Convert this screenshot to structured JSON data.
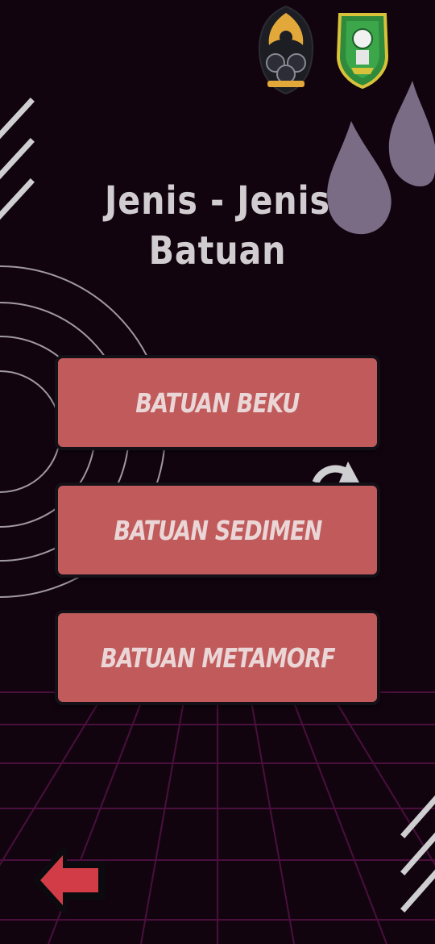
{
  "title": {
    "line1": "Jenis - Jenis",
    "line2": "Batuan"
  },
  "menu": [
    {
      "label": "BATUAN BEKU"
    },
    {
      "label": "BATUAN SEDIMEN"
    },
    {
      "label": "BATUAN METAMORF"
    }
  ],
  "colors": {
    "background": "#12040f",
    "button": "#c05a5b",
    "button_text": "#ead6d6",
    "title": "#d0cccf",
    "back_arrow": "#d13c47",
    "grid": "#4a0f3d",
    "drop": "#7b6c86"
  },
  "icons": {
    "left_logo": "university-emblem-icon",
    "right_logo": "regional-emblem-icon",
    "back": "back-arrow-icon",
    "refresh": "refresh-icon"
  }
}
